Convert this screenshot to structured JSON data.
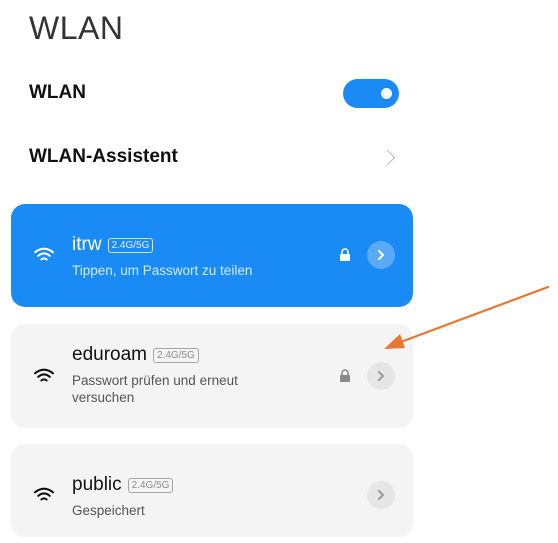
{
  "page": {
    "title": "WLAN"
  },
  "settings": {
    "wlan_label": "WLAN",
    "wlan_enabled": true,
    "assistant_label": "WLAN-Assistent"
  },
  "networks": [
    {
      "name": "itrw",
      "band": "2.4G/5G",
      "status": "Tippen, um Passwort zu teilen",
      "secured": true,
      "connected": true,
      "icon": "wifi-icon"
    },
    {
      "name": "eduroam",
      "band": "2.4G/5G",
      "status": "Passwort prüfen und erneut versuchen",
      "secured": true,
      "connected": false,
      "icon": "wifi-icon"
    },
    {
      "name": "public",
      "band": "2.4G/5G",
      "status": "Gespeichert",
      "secured": false,
      "connected": false,
      "icon": "wifi-icon"
    }
  ],
  "colors": {
    "accent": "#1a8bf5",
    "card_background": "#f4f4f4",
    "annotation_arrow": "#e8782f"
  }
}
